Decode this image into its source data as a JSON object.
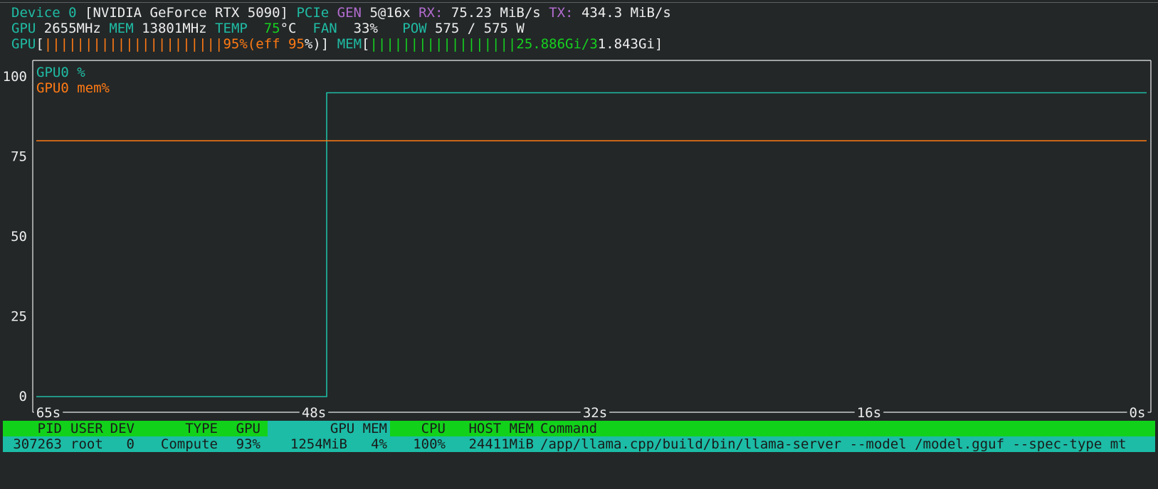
{
  "device": {
    "label": "Device",
    "index": "0",
    "name": "[NVIDIA GeForce RTX 5090]",
    "pcie_label": "PCIe",
    "gen_label": "GEN",
    "gen_value": "5@16x",
    "rx_label": "RX:",
    "rx_value": "75.23 MiB/s",
    "tx_label": "TX:",
    "tx_value": "434.3 MiB/s"
  },
  "stats": {
    "gpu_label": "GPU",
    "gpu_clock": "2655MHz",
    "mem_label": "MEM",
    "mem_clock": "13801MHz",
    "temp_label": "TEMP",
    "temp_value": "75",
    "temp_unit": "°C",
    "fan_label": "FAN",
    "fan_value": "33%",
    "pow_label": "POW",
    "pow_value": "575 / 575 W"
  },
  "bars": {
    "gpu_label": "GPU",
    "gpu_bar": "||||||||||||||||||||||",
    "gpu_percent": "95%",
    "gpu_eff_open": "(eff",
    "gpu_eff_value": "95",
    "gpu_eff_close": "%)",
    "mem_label": "MEM",
    "mem_bar": "||||||||||||||||||",
    "mem_used": "25.886Gi/3",
    "mem_total": "1.843Gi",
    "open_bracket": "[",
    "close_bracket": "]"
  },
  "chart_data": {
    "type": "line",
    "y_ticks": [
      "100",
      "75",
      "50",
      "25",
      "0"
    ],
    "x_ticks": [
      "65s",
      "48s",
      "32s",
      "16s",
      "0s"
    ],
    "ylim": [
      0,
      100
    ],
    "xlim": [
      -65,
      0
    ],
    "series": [
      {
        "name": "GPU0 %",
        "color": "#1fbca4",
        "x": [
          -65,
          -48,
          -48,
          0
        ],
        "y": [
          0,
          0,
          95,
          95
        ]
      },
      {
        "name": "GPU0 mem%",
        "color": "#ff7a14",
        "x": [
          -65,
          0
        ],
        "y": [
          80,
          80
        ]
      }
    ]
  },
  "table": {
    "headers": {
      "pid": "PID",
      "user": "USER",
      "dev": "DEV",
      "type": "TYPE",
      "gpu": "GPU",
      "gpu_mem": "GPU MEM",
      "cpu": "CPU",
      "host_mem": "HOST MEM",
      "command": "Command"
    },
    "rows": [
      {
        "pid": "307263",
        "user": "root",
        "dev": "0",
        "type": "Compute",
        "gpu": "93%",
        "gpu_mem": "1254MiB",
        "gpu_mem_pct": "4%",
        "cpu": "100%",
        "host_mem": "24411MiB",
        "command": "/app/llama.cpp/build/bin/llama-server --model /model.gguf --spec-type mt"
      }
    ]
  },
  "colors": {
    "background": "#232728",
    "teal": "#1fbca4",
    "orange": "#ff7a14",
    "green": "#15d11f",
    "purple": "#b26ccf"
  }
}
